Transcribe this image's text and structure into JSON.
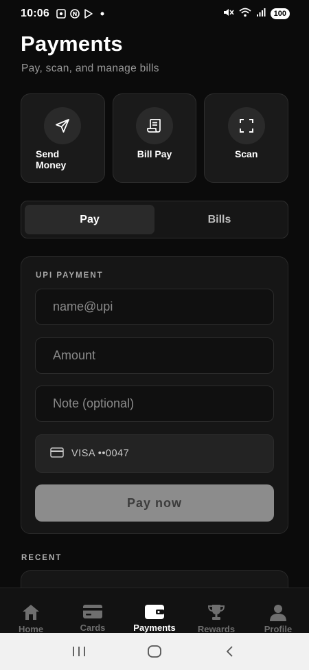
{
  "status_bar": {
    "time": "10:06",
    "battery": "100"
  },
  "header": {
    "title": "Payments",
    "subtitle": "Pay, scan, and manage bills"
  },
  "quick_actions": [
    {
      "label": "Send Money",
      "icon": "send-icon"
    },
    {
      "label": "Bill Pay",
      "icon": "receipt-icon"
    },
    {
      "label": "Scan",
      "icon": "scan-icon"
    }
  ],
  "tabs": [
    {
      "label": "Pay",
      "active": true
    },
    {
      "label": "Bills",
      "active": false
    }
  ],
  "payment_form": {
    "section_title": "UPI PAYMENT",
    "upi_placeholder": "name@upi",
    "amount_placeholder": "Amount",
    "note_placeholder": "Note (optional)",
    "card_label": "VISA ••0047",
    "submit_label": "Pay now"
  },
  "recent": {
    "title": "RECENT"
  },
  "bottom_nav": [
    {
      "label": "Home",
      "icon": "home-icon",
      "active": false
    },
    {
      "label": "Cards",
      "icon": "card-icon",
      "active": false
    },
    {
      "label": "Payments",
      "icon": "wallet-icon",
      "active": true
    },
    {
      "label": "Rewards",
      "icon": "trophy-icon",
      "active": false
    },
    {
      "label": "Profile",
      "icon": "person-icon",
      "active": false
    }
  ],
  "colors": {
    "background": "#0b0b0b",
    "surface": "#161616",
    "button_disabled": "#8c8c8c"
  }
}
